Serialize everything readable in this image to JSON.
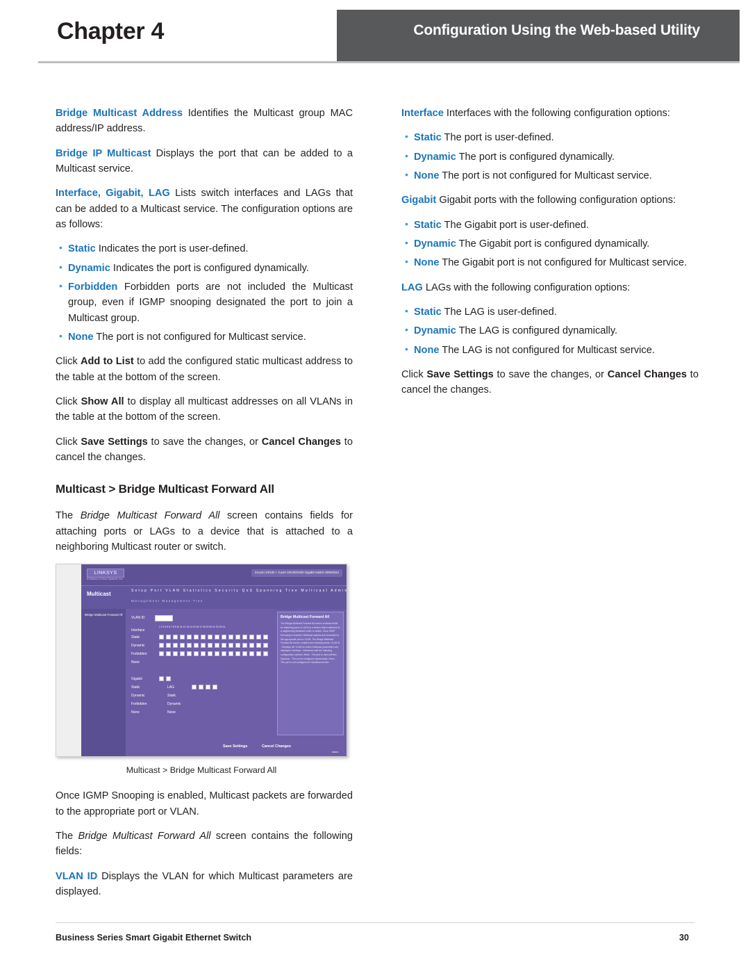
{
  "header": {
    "chapter_label": "Chapter",
    "chapter_number": "4",
    "running_title": "Configuration Using the Web-based Utility"
  },
  "left_column": {
    "p1_term": "Bridge Multicast Address",
    "p1_text": "Identifies the Multicast group MAC address/IP address.",
    "p2_term": "Bridge IP Multicast",
    "p2_text": "Displays the port that can be added to a Multicast service.",
    "p3_term": "Interface, Gigabit, LAG",
    "p3_text": "Lists switch interfaces and LAGs that can be added to a Multicast service. The configuration options are as follows:",
    "bullets": [
      {
        "term": "Static",
        "text": "Indicates the port is user-defined."
      },
      {
        "term": "Dynamic",
        "text": "Indicates the port is configured dynamically."
      },
      {
        "term": "Forbidden",
        "text": "Forbidden ports are not included the Multicast group, even if IGMP snooping designated the port to join a Multicast group."
      },
      {
        "term": "None",
        "text": "The port is not configured for Multicast service."
      }
    ],
    "p4_a": "Click ",
    "p4_b": "Add to List",
    "p4_c": " to add the configured static multicast address to the table at the bottom of the screen.",
    "p5_a": "Click ",
    "p5_b": "Show All",
    "p5_c": " to display all multicast addresses on all VLANs in the table at the bottom of the screen.",
    "p6_a": "Click ",
    "p6_b": "Save Settings",
    "p6_c": " to save the changes, or ",
    "p6_d": "Cancel Changes",
    "p6_e": " to cancel the changes.",
    "section_heading": "Multicast > Bridge Multicast Forward All",
    "p7_a": "The ",
    "p7_b": "Bridge Multicast Forward All",
    "p7_c": " screen contains fields for attaching ports or LAGs to a device that is attached to a neighboring Multicast router or switch.",
    "figure_caption": "Multicast > Bridge Multicast Forward All",
    "p8": "Once IGMP Snooping is enabled, Multicast packets are forwarded to the appropriate port or VLAN.",
    "p9_a": "The ",
    "p9_b": "Bridge Multicast Forward All",
    "p9_c": " screen contains the following fields:",
    "p10_term": "VLAN ID",
    "p10_text": "Displays the VLAN for which Multicast parameters are displayed."
  },
  "right_column": {
    "p1_term": "Interface",
    "p1_text": "Interfaces with the following configuration options:",
    "bullets1": [
      {
        "term": "Static",
        "text": "The port is user-defined."
      },
      {
        "term": "Dynamic",
        "text": "The port is configured dynamically."
      },
      {
        "term": "None",
        "text": "The port is not configured for Multicast service."
      }
    ],
    "p2_term": "Gigabit",
    "p2_text": "Gigabit ports with the following configuration options:",
    "bullets2": [
      {
        "term": "Static",
        "text": "The Gigabit port is user-defined."
      },
      {
        "term": "Dynamic",
        "text": "The Gigabit port is configured dynamically."
      },
      {
        "term": "None",
        "text": "The Gigabit port is not configured for Multicast service."
      }
    ],
    "p3_term": "LAG",
    "p3_text": "LAGs with the following configuration options:",
    "bullets3": [
      {
        "term": "Static",
        "text": "The LAG is user-defined."
      },
      {
        "term": "Dynamic",
        "text": "The LAG is configured dynamically."
      },
      {
        "term": "None",
        "text": "The LAG is not configured for Multicast service."
      }
    ],
    "p4_a": "Click ",
    "p4_b": "Save Settings",
    "p4_c": " to save the changes, or ",
    "p4_d": "Cancel Changes",
    "p4_e": " to cancel the changes."
  },
  "figure": {
    "logo": "LINKSYS",
    "logo_sub": "A Division of Cisco Systems, Inc.",
    "section_tag": "Multicast",
    "menu_row1": "Setup   Port   VLAN   Statistics   Security   QoS   Spanning Tree   Multicast   Admin   LogOut",
    "menu_row2": "Management   Management                              Tree",
    "device_label": "24-port 10/100 + 2-port 10/100/1000 Gigabit Switch  SRW2024",
    "device_model": "SRW2024",
    "sidebar_text": "Bridge Multicast\nForward All",
    "help_title": "Bridge Multicast Forward All",
    "help_body": "The Bridge Multicast Forward All screen contains fields for attaching ports or LAGs to a device that is attached to a neighboring Multicast router or switch.\n\nOnce IGMP Snooping is enabled, Multicast packets are forwarded to the appropriate port or VLAN.\n\nThe Bridge Multicast Forward All screen contains the following fields:\n\nVLAN ID - Displays the VLAN for which Multicast parameters are displayed.\n\nInterface - Interfaces with the following configuration options:\n\nStatic - The port is user-defined.\n\nDynamic - The port is configured dynamically.\n\nNone - The port is not configured for Multicast service.",
    "vlan_label": "VLAN ID",
    "vlan_value": "1",
    "interface_label": "Interface",
    "rows": [
      "Static",
      "Dynamic",
      "Forbidden",
      "None"
    ],
    "gigabit_label": "Gigabit",
    "lag_label": "LAG",
    "btn_save": "Save Settings",
    "btn_cancel": "Cancel Changes",
    "brand": "cisco"
  },
  "footer": {
    "left": "Business Series Smart Gigabit Ethernet Switch",
    "page": "30"
  }
}
